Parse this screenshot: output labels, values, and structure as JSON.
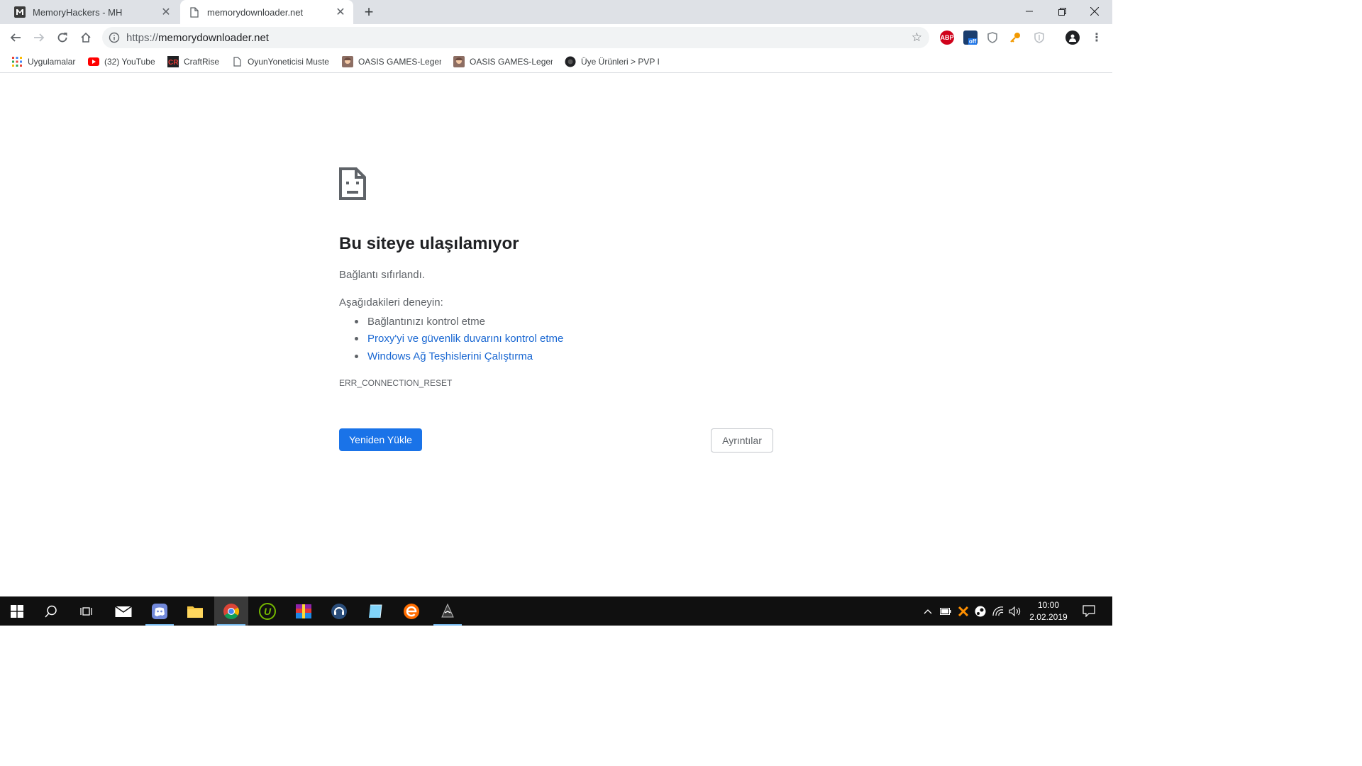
{
  "tabs": [
    {
      "title": "MemoryHackers - MH",
      "favicon": "memoryhackers-m-icon",
      "active": false
    },
    {
      "title": "memorydownloader.net",
      "favicon": "page-icon",
      "active": true
    }
  ],
  "window_controls": {
    "minimize": "minimize-icon",
    "restore": "restore-icon",
    "close": "close-icon"
  },
  "toolbar": {
    "url_scheme": "https://",
    "url_host": "memorydownloader.net",
    "extensions": [
      {
        "name": "adblock-plus-icon",
        "label": "ABP"
      },
      {
        "name": "extension-off-icon",
        "label": "off"
      },
      {
        "name": "shield-extension-icon",
        "label": ""
      },
      {
        "name": "key-extension-icon",
        "label": ""
      },
      {
        "name": "shield-outline-extension-icon",
        "label": ""
      }
    ]
  },
  "bookmarks": [
    {
      "label": "Uygulamalar",
      "icon": "apps-grid-icon"
    },
    {
      "label": "(32) YouTube",
      "icon": "youtube-icon"
    },
    {
      "label": "CraftRise",
      "icon": "craftrise-icon"
    },
    {
      "label": "OyunYoneticisi Muste",
      "icon": "page-icon"
    },
    {
      "label": "OASIS GAMES-Legen",
      "icon": "oasis-games-icon"
    },
    {
      "label": "OASIS GAMES-Legen",
      "icon": "oasis-games-icon"
    },
    {
      "label": "Üye Ürünleri > PVP I",
      "icon": "pvp-icon"
    }
  ],
  "error_page": {
    "title": "Bu siteye ulaşılamıyor",
    "description": "Bağlantı sıfırlandı.",
    "try_heading": "Aşağıdakileri deneyin:",
    "suggestions": [
      {
        "text": "Bağlantınızı kontrol etme",
        "is_link": false
      },
      {
        "text": "Proxy'yi ve güvenlik duvarını kontrol etme",
        "is_link": true
      },
      {
        "text": "Windows Ağ Teşhislerini Çalıştırma",
        "is_link": true
      }
    ],
    "error_code": "ERR_CONNECTION_RESET",
    "reload_button": "Yeniden Yükle",
    "details_button": "Ayrıntılar"
  },
  "taskbar": {
    "apps": [
      "start-icon",
      "search-icon",
      "task-view-icon",
      "mail-icon",
      "discord-icon",
      "file-explorer-icon",
      "chrome-icon",
      "utorrent-icon",
      "winrar-icon",
      "teamspeak-icon",
      "app-icon",
      "browser-e-icon",
      "game-icon"
    ],
    "clock_time": "10:00",
    "clock_date": "2.02.2019"
  },
  "colors": {
    "accent": "#1a73e8",
    "link": "#1967d2",
    "taskbar": "#101010"
  }
}
